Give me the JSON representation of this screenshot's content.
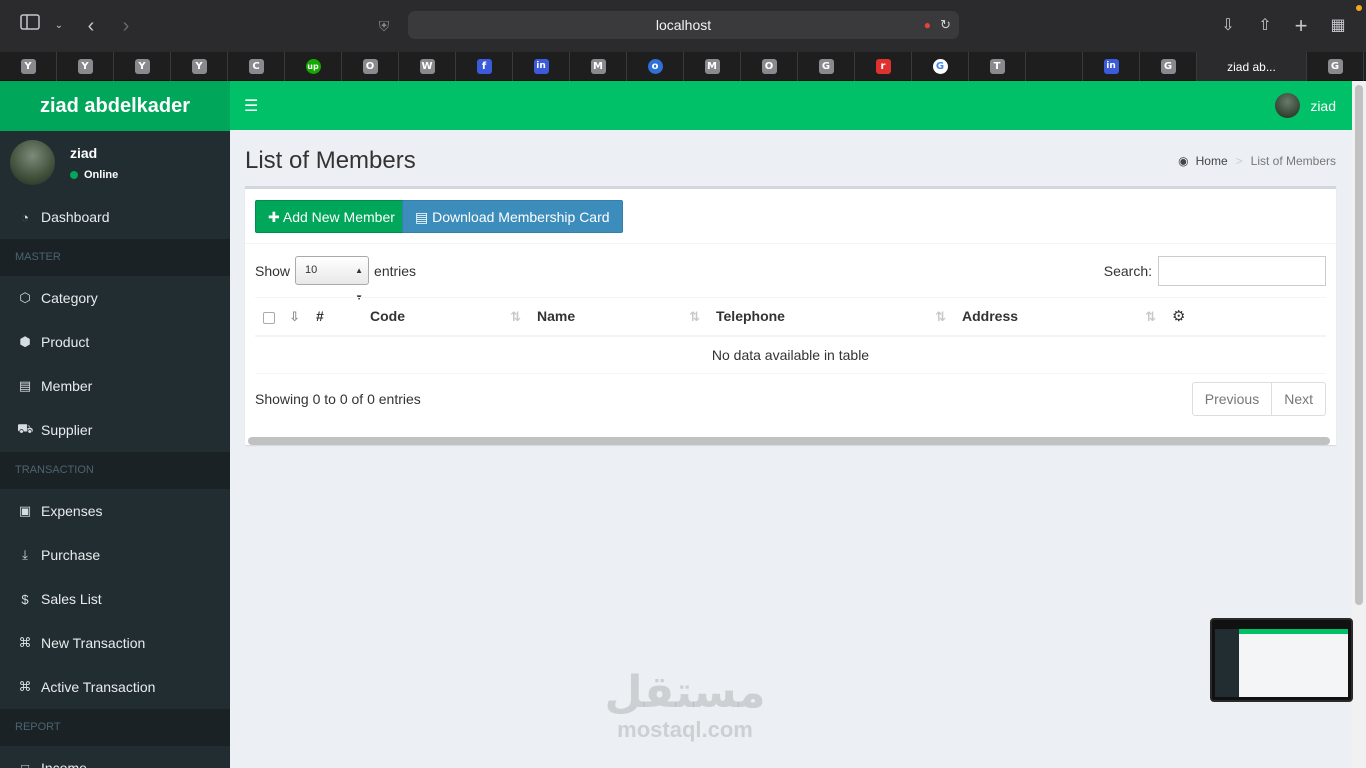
{
  "browser": {
    "url": "localhost",
    "active_tab": "ziad ab...",
    "favorites": [
      "Y",
      "Y",
      "Y",
      "Y",
      "C",
      "up",
      "O",
      "W",
      "f",
      "in",
      "M",
      "o",
      "M",
      "O",
      "G",
      "r",
      "G",
      "T",
      "",
      "in",
      "G"
    ],
    "last_favorite": "G"
  },
  "app": {
    "brand": "ziad abdelkader",
    "top_user": "ziad"
  },
  "sidebar": {
    "user_name": "ziad",
    "user_status": "Online",
    "items": [
      {
        "type": "item",
        "label": "Dashboard",
        "icon": "dashboard-icon"
      },
      {
        "type": "header",
        "label": "MASTER"
      },
      {
        "type": "item",
        "label": "Category",
        "icon": "cube-icon"
      },
      {
        "type": "item",
        "label": "Product",
        "icon": "cubes-icon"
      },
      {
        "type": "item",
        "label": "Member",
        "icon": "id-card-icon"
      },
      {
        "type": "item",
        "label": "Supplier",
        "icon": "truck-icon"
      },
      {
        "type": "header",
        "label": "TRANSACTION"
      },
      {
        "type": "item",
        "label": "Expenses",
        "icon": "money-icon"
      },
      {
        "type": "item",
        "label": "Purchase",
        "icon": "download-icon"
      },
      {
        "type": "item",
        "label": "Sales List",
        "icon": "dollar-icon"
      },
      {
        "type": "item",
        "label": "New Transaction",
        "icon": "cart-icon"
      },
      {
        "type": "item",
        "label": "Active Transaction",
        "icon": "cart-icon"
      },
      {
        "type": "header",
        "label": "REPORT"
      },
      {
        "type": "item",
        "label": "Income",
        "icon": "file-icon"
      }
    ]
  },
  "page": {
    "title": "List of Members",
    "breadcrumb_home": "Home",
    "breadcrumb_current": "List of Members"
  },
  "toolbar": {
    "add_label": "Add New Member",
    "download_label": "Download Membership Card"
  },
  "table": {
    "show_label": "Show",
    "entries_label": "entries",
    "page_size": "10",
    "search_label": "Search:",
    "search_value": "",
    "columns": [
      "#",
      "Code",
      "Name",
      "Telephone",
      "Address"
    ],
    "empty_message": "No data available in table",
    "info": "Showing 0 to 0 of 0 entries",
    "prev_label": "Previous",
    "next_label": "Next"
  },
  "watermark": {
    "arabic": "مستقل",
    "latin": "mostaql.com"
  },
  "colors": {
    "brand_green": "#00a65a",
    "topbar_green": "#00c167",
    "sidebar_bg": "#222d32",
    "primary_blue": "#3c8dbc"
  }
}
